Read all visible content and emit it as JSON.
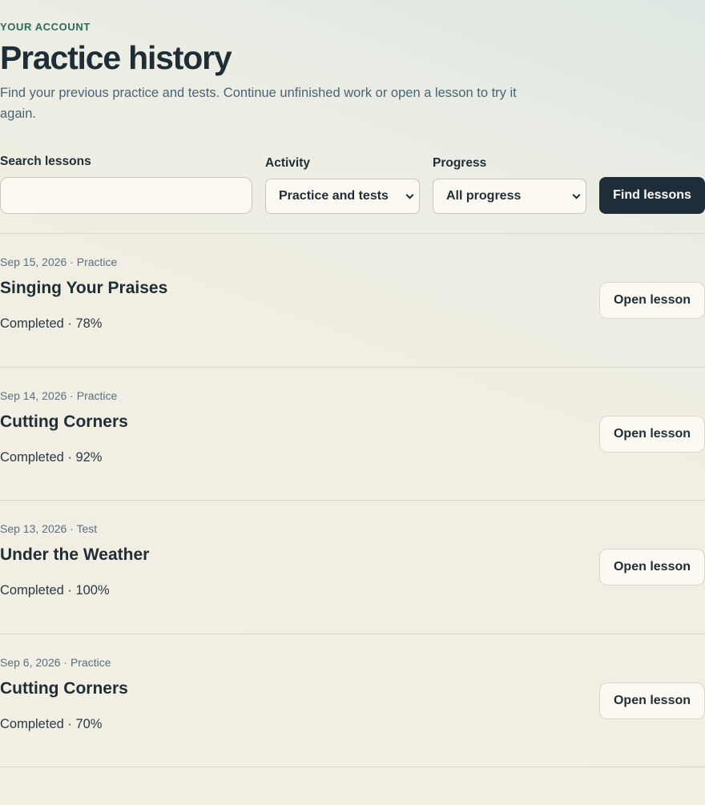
{
  "header": {
    "eyebrow": "YOUR ACCOUNT",
    "title": "Practice history",
    "subtitle": "Find your previous practice and tests. Continue unfinished work or open a lesson to try it again."
  },
  "filters": {
    "search_label": "Search lessons",
    "search_value": "",
    "activity_label": "Activity",
    "activity_selected": "Practice and tests",
    "progress_label": "Progress",
    "progress_selected": "All progress",
    "submit_label": "Find lessons"
  },
  "lessons": [
    {
      "meta": "Sep 15, 2026 · Practice",
      "title": "Singing Your Praises",
      "status": "Completed · 78%",
      "action": "Open lesson"
    },
    {
      "meta": "Sep 14, 2026 · Practice",
      "title": "Cutting Corners",
      "status": "Completed · 92%",
      "action": "Open lesson"
    },
    {
      "meta": "Sep 13, 2026 · Test",
      "title": "Under the Weather",
      "status": "Completed · 100%",
      "action": "Open lesson"
    },
    {
      "meta": "Sep 6, 2026 · Practice",
      "title": "Cutting Corners",
      "status": "Completed · 70%",
      "action": "Open lesson"
    }
  ],
  "colors": {
    "accent_dark": "#1f2d38",
    "eyebrow_green": "#2f6b5c",
    "muted_text": "#4a6475",
    "background": "#f2efe4"
  }
}
